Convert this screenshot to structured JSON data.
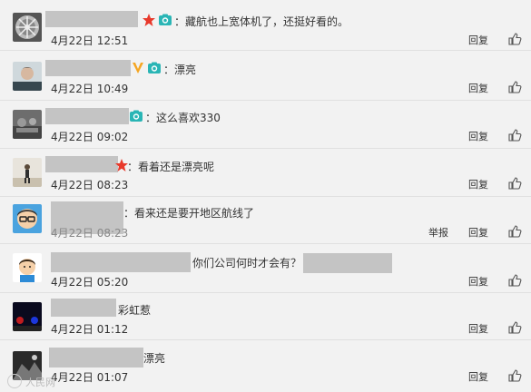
{
  "comments": [
    {
      "text": "：藏航也上宽体机了，还挺好看的。",
      "time": "4月22日 12:51",
      "reply": "回复",
      "badges": [
        "star-badge",
        "camera-badge"
      ],
      "report": ""
    },
    {
      "text": "：漂亮",
      "time": "4月22日 10:49",
      "reply": "回复",
      "badges": [
        "vip-badge",
        "camera-badge"
      ],
      "report": ""
    },
    {
      "text": "：这么喜欢330",
      "time": "4月22日 09:02",
      "reply": "回复",
      "badges": [
        "camera-badge"
      ],
      "report": ""
    },
    {
      "text": "：看着还是漂亮呢",
      "time": "4月22日 08:23",
      "reply": "回复",
      "badges": [
        "star-badge"
      ],
      "report": ""
    },
    {
      "text": "：看来还是要开地区航线了",
      "time": "4月22日 08:23",
      "reply": "回复",
      "badges": [],
      "report": "举报"
    },
    {
      "text": "你们公司何时才会有？",
      "time": "4月22日 05:20",
      "reply": "回复",
      "badges": [],
      "report": ""
    },
    {
      "text": "彩虹惹",
      "time": "4月22日 01:12",
      "reply": "回复",
      "badges": [],
      "report": ""
    },
    {
      "text": "漂亮",
      "time": "4月22日 01:07",
      "reply": "回复",
      "badges": [],
      "report": ""
    }
  ],
  "watermark": "人民网",
  "colors": {
    "star": "#e8392b",
    "camera": "#2ab5b5",
    "vip": "#f5a623",
    "background": "#f2f2f2",
    "redaction": "#c4c4c4"
  },
  "icons": {
    "like": "thumbs-up-icon",
    "camera": "camera-badge-icon",
    "star": "star-badge-icon",
    "vip": "vip-badge-icon"
  }
}
